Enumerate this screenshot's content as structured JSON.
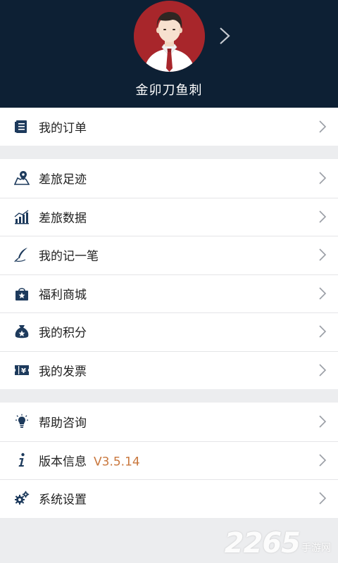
{
  "profile": {
    "username": "金卯刀鱼刺",
    "avatar_icon": "businessman-avatar-icon",
    "arrow_icon": "chevron-right-icon"
  },
  "colors": {
    "header_bg": "#0d2034",
    "avatar_bg": "#a8262b",
    "icon": "#1d3a5c",
    "version": "#c9773d",
    "page_bg": "#ecedef"
  },
  "menu": {
    "orders": {
      "label": "我的订单",
      "icon": "order-document-icon"
    },
    "travel_track": {
      "label": "差旅足迹",
      "icon": "map-pin-icon"
    },
    "travel_data": {
      "label": "差旅数据",
      "icon": "bar-chart-icon"
    },
    "notes": {
      "label": "我的记一笔",
      "icon": "quill-pen-icon"
    },
    "mall": {
      "label": "福利商城",
      "icon": "shopping-bag-icon"
    },
    "points": {
      "label": "我的积分",
      "icon": "money-bag-icon"
    },
    "invoice": {
      "label": "我的发票",
      "icon": "yen-ticket-icon"
    },
    "help": {
      "label": "帮助咨询",
      "icon": "lightbulb-icon"
    },
    "version": {
      "label": "版本信息",
      "value": "V3.5.14",
      "icon": "info-icon"
    },
    "settings": {
      "label": "系统设置",
      "icon": "gears-icon"
    }
  },
  "watermark": {
    "number": "2265",
    "text": "手游网"
  }
}
